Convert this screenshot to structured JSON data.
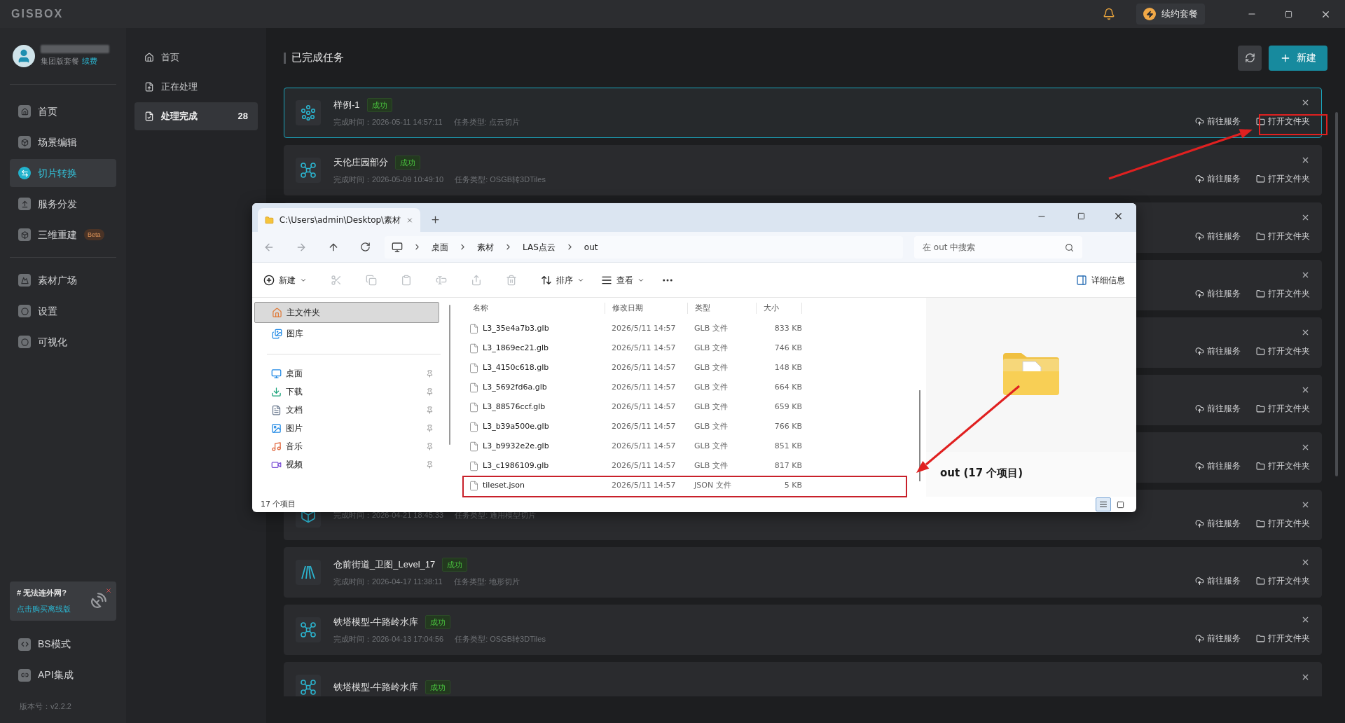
{
  "app": {
    "logo": "GISBOX",
    "renew": "续约套餐"
  },
  "user": {
    "plan": "集团版套餐",
    "renew_link": "续费"
  },
  "nav": [
    {
      "label": "首页",
      "selected": false
    },
    {
      "label": "场景编辑",
      "selected": false
    },
    {
      "label": "切片转换",
      "selected": true
    },
    {
      "label": "服务分发",
      "selected": false
    },
    {
      "label": "三维重建",
      "badge": "Beta",
      "selected": false
    }
  ],
  "nav_more": [
    {
      "label": "素材广场",
      "selected": false
    },
    {
      "label": "设置",
      "selected": false
    },
    {
      "label": "可视化",
      "selected": false
    }
  ],
  "promo": {
    "title": "# 无法连外网?",
    "link": "点击购买离线版"
  },
  "nav_bottom": [
    {
      "label": "BS模式"
    },
    {
      "label": "API集成"
    }
  ],
  "version": "版本号：v2.2.2",
  "subnav": [
    {
      "label": "首页",
      "selected": false
    },
    {
      "label": "正在处理",
      "selected": false
    },
    {
      "label": "处理完成",
      "count": "28",
      "selected": true
    }
  ],
  "page_title": "已完成任务",
  "new_button": "新建",
  "tasks": [
    {
      "kind": "point-cloud",
      "name": "样例-1",
      "status": "成功",
      "time": "完成时间：2026-05-11 14:57:11",
      "type": "任务类型: 点云切片",
      "actions": [
        "前往服务",
        "打开文件夹"
      ],
      "selected": true
    },
    {
      "kind": "osgb",
      "name": "天伦庄园部分",
      "status": "成功",
      "time": "完成时间：2026-05-09 10:49:10",
      "type": "任务类型: OSGB转3DTiles",
      "actions": [
        "前往服务",
        "打开文件夹"
      ],
      "selected": false
    },
    {
      "kind": "hidden",
      "actions": [
        "前往服务",
        "打开文件夹"
      ],
      "selected": false
    },
    {
      "kind": "hidden",
      "actions": [
        "前往服务",
        "打开文件夹"
      ],
      "selected": false
    },
    {
      "kind": "hidden",
      "actions": [
        "前往服务",
        "打开文件夹"
      ],
      "selected": false
    },
    {
      "kind": "hidden",
      "actions": [
        "前往服务",
        "打开文件夹"
      ],
      "selected": false
    },
    {
      "kind": "hidden",
      "actions": [
        "前往服务",
        "打开文件夹"
      ],
      "selected": false
    },
    {
      "kind": "model",
      "time": "完成时间：2026-04-21 18:45:33",
      "type": "任务类型: 通用模型切片",
      "actions": [
        "前往服务",
        "打开文件夹"
      ],
      "selected": false
    },
    {
      "kind": "terrain",
      "name": "仓前街道_卫图_Level_17",
      "status": "成功",
      "time": "完成时间：2026-04-17 11:38:11",
      "type": "任务类型: 地形切片",
      "actions": [
        "前往服务",
        "打开文件夹"
      ],
      "selected": false
    },
    {
      "kind": "osgb",
      "name": "铁塔模型-牛路岭水库",
      "status": "成功",
      "time": "完成时间：2026-04-13 17:04:56",
      "type": "任务类型: OSGB转3DTiles",
      "actions": [
        "前往服务",
        "打开文件夹"
      ],
      "selected": false
    },
    {
      "kind": "osgb",
      "name": "铁塔模型-牛路岭水库",
      "status": "成功",
      "selected": false
    }
  ],
  "explorer": {
    "tab_title": "C:\\Users\\admin\\Desktop\\素材",
    "path": [
      "桌面",
      "素材",
      "LAS点云",
      "out"
    ],
    "search_placeholder": "在 out 中搜索",
    "toolbar": {
      "new": "新建",
      "sort": "排序",
      "view": "查看",
      "details": "详细信息"
    },
    "quick": [
      {
        "label": "主文件夹",
        "selected": true
      },
      {
        "label": "图库",
        "selected": false
      }
    ],
    "pinned": [
      {
        "label": "桌面"
      },
      {
        "label": "下载"
      },
      {
        "label": "文档"
      },
      {
        "label": "图片"
      },
      {
        "label": "音乐"
      },
      {
        "label": "视频"
      }
    ],
    "status": "17 个项目",
    "columns": [
      "名称",
      "修改日期",
      "类型",
      "大小"
    ],
    "files": [
      {
        "name": "L3_35e4a7b3.glb",
        "date": "2026/5/11 14:57",
        "type": "GLB 文件",
        "size": "833 KB"
      },
      {
        "name": "L3_1869ec21.glb",
        "date": "2026/5/11 14:57",
        "type": "GLB 文件",
        "size": "746 KB"
      },
      {
        "name": "L3_4150c618.glb",
        "date": "2026/5/11 14:57",
        "type": "GLB 文件",
        "size": "148 KB"
      },
      {
        "name": "L3_5692fd6a.glb",
        "date": "2026/5/11 14:57",
        "type": "GLB 文件",
        "size": "664 KB"
      },
      {
        "name": "L3_88576ccf.glb",
        "date": "2026/5/11 14:57",
        "type": "GLB 文件",
        "size": "659 KB"
      },
      {
        "name": "L3_b39a500e.glb",
        "date": "2026/5/11 14:57",
        "type": "GLB 文件",
        "size": "766 KB"
      },
      {
        "name": "L3_b9932e2e.glb",
        "date": "2026/5/11 14:57",
        "type": "GLB 文件",
        "size": "851 KB"
      },
      {
        "name": "L3_c1986109.glb",
        "date": "2026/5/11 14:57",
        "type": "GLB 文件",
        "size": "817 KB"
      },
      {
        "name": "tileset.json",
        "date": "2026/5/11 14:57",
        "type": "JSON 文件",
        "size": "5 KB"
      }
    ],
    "preview_caption": "out (17 个项目)",
    "view_modes": [
      {
        "kind": "details",
        "selected": true
      },
      {
        "kind": "tiles",
        "selected": false
      }
    ]
  }
}
